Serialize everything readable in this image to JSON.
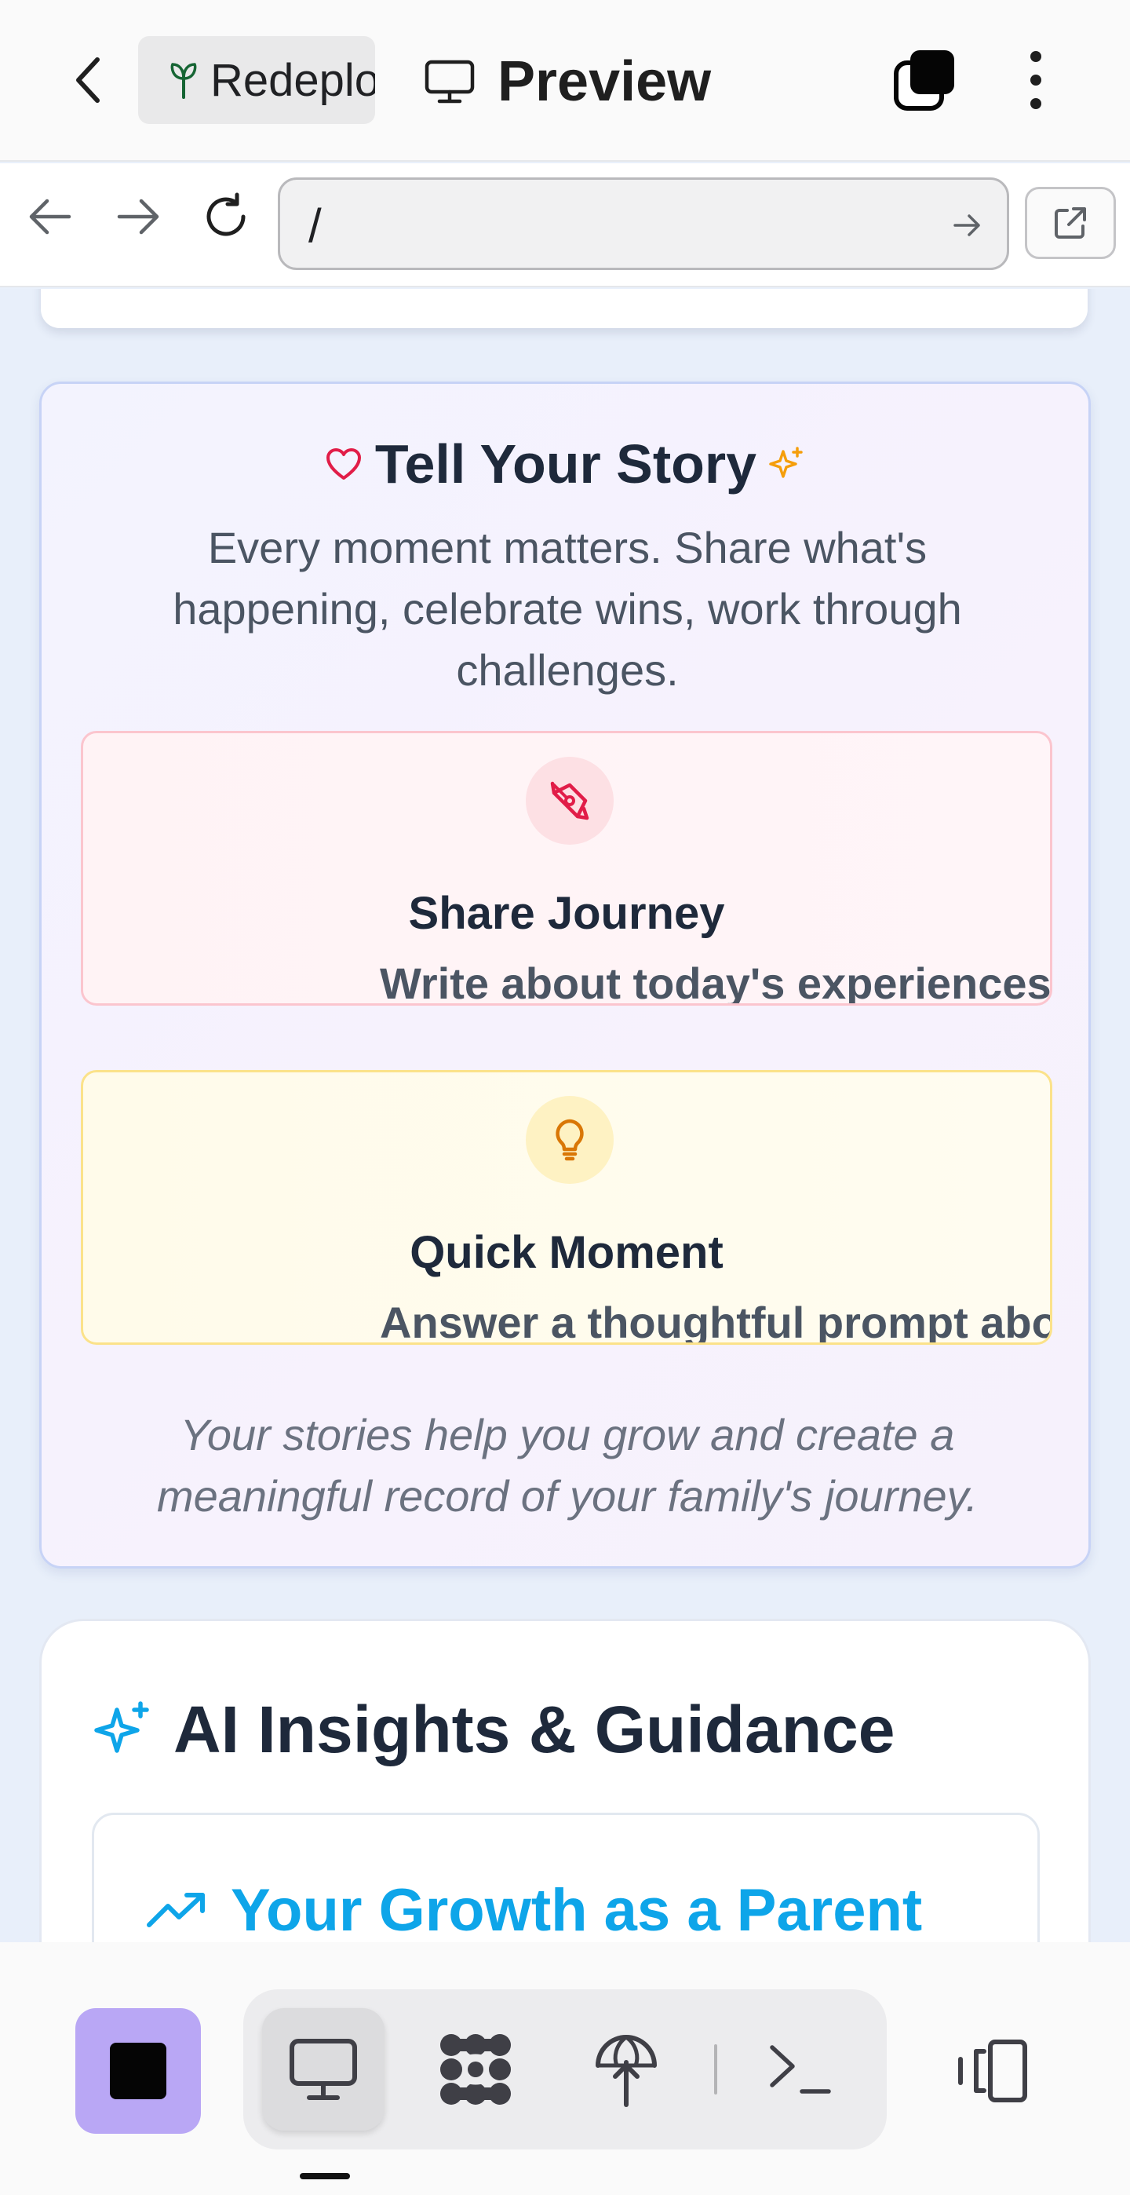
{
  "app_bar": {
    "back_icon": "chevron-left-icon",
    "project_name": "Redeploy",
    "project_icon": "plant-icon",
    "preview_tab_label": "Preview",
    "preview_icon": "monitor-icon",
    "layers_icon": "layers-icon",
    "more_icon": "more-vertical-icon"
  },
  "browser_bar": {
    "url": "/",
    "back_icon": "arrow-left-icon",
    "forward_icon": "arrow-right-icon",
    "reload_icon": "reload-icon",
    "go_icon": "arrow-right-icon",
    "open_external_icon": "external-link-icon"
  },
  "story_card": {
    "title": "Tell Your Story",
    "description": "Every moment matters. Share what's happening, celebrate wins, work through challenges.",
    "actions": [
      {
        "title": "Share Journey",
        "subtitle": "Write about today's experiences and",
        "icon": "pen-icon",
        "color": "#e11d48"
      },
      {
        "title": "Quick Moment",
        "subtitle": "Answer a thoughtful prompt about",
        "icon": "lightbulb-icon",
        "color": "#d97706"
      }
    ],
    "footer": "Your stories help you grow and create a meaningful record of your family's journey."
  },
  "ai_card": {
    "title": "AI Insights & Guidance",
    "icon": "sparkles-icon",
    "growth_title": "Your Growth as a Parent",
    "growth_icon": "trending-up-icon",
    "accent_color": "#0ea5e9"
  },
  "bottom_bar": {
    "stop_icon": "stop-icon",
    "tools": [
      {
        "name": "preview",
        "icon": "monitor-icon",
        "active": true
      },
      {
        "name": "integrations",
        "icon": "grid-blobs-icon",
        "active": false
      },
      {
        "name": "deploy",
        "icon": "deploy-icon",
        "active": false
      },
      {
        "name": "terminal",
        "icon": "terminal-icon",
        "active": false
      }
    ],
    "devices_icon": "devices-icon"
  }
}
